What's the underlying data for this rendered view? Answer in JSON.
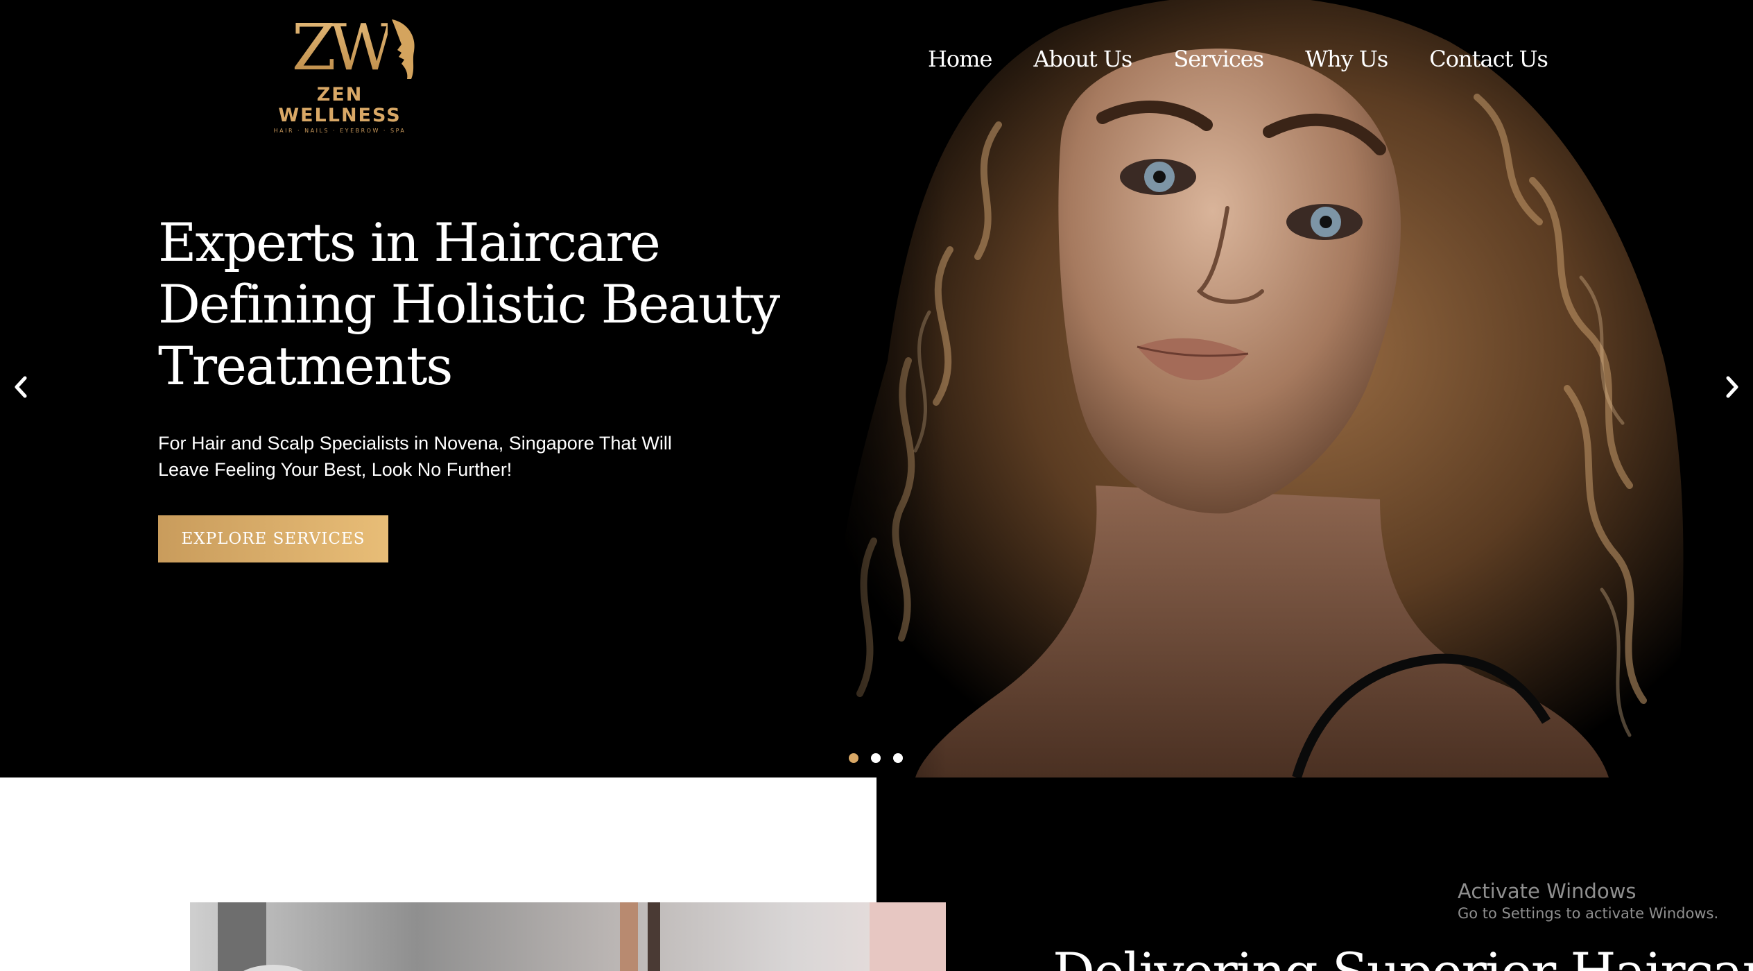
{
  "logo": {
    "monogram": "ZW",
    "name": "ZEN WELLNESS",
    "tagline": "HAIR · NAILS · EYEBROW · SPA"
  },
  "nav": {
    "items": [
      {
        "label": "Home"
      },
      {
        "label": "About Us"
      },
      {
        "label": "Services"
      },
      {
        "label": "Why Us"
      },
      {
        "label": "Contact Us"
      }
    ]
  },
  "hero": {
    "headline_line1": "Experts in Haircare",
    "headline_line2": "Defining Holistic Beauty",
    "headline_line3": "Treatments",
    "subheadline": "For Hair and Scalp Specialists in Novena, Singapore That Will Leave Feeling Your Best, Look No Further!",
    "cta_label": "EXPLORE SERVICES",
    "slide_count": 3,
    "active_slide": 1
  },
  "section": {
    "heading": "Delivering Superior Haircare"
  },
  "system_overlay": {
    "title": "Activate Windows",
    "subtitle": "Go to Settings to activate Windows."
  },
  "colors": {
    "accent_gold": "#d9a866",
    "background": "#000000",
    "text": "#ffffff"
  }
}
